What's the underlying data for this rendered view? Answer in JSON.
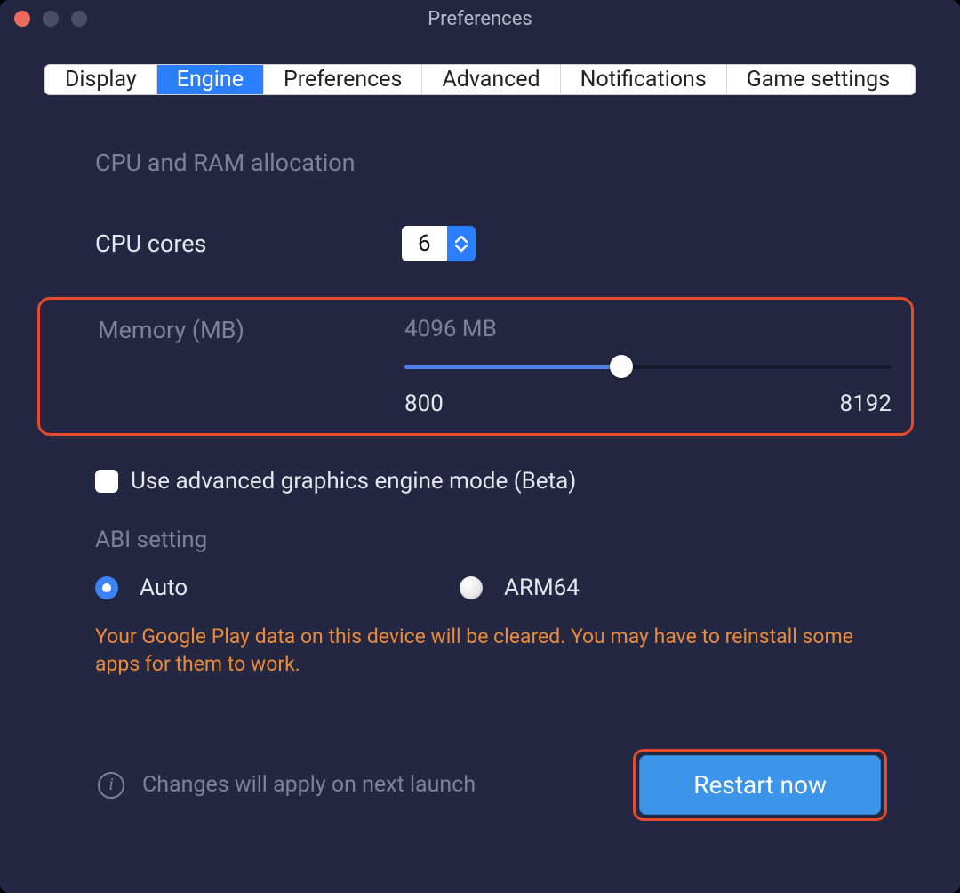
{
  "window": {
    "title": "Preferences"
  },
  "tabs": [
    {
      "label": "Display",
      "active": false
    },
    {
      "label": "Engine",
      "active": true
    },
    {
      "label": "Preferences",
      "active": false
    },
    {
      "label": "Advanced",
      "active": false
    },
    {
      "label": "Notifications",
      "active": false
    },
    {
      "label": "Game settings",
      "active": false
    }
  ],
  "section_heading": "CPU and RAM allocation",
  "cpu": {
    "label": "CPU cores",
    "value": "6"
  },
  "memory": {
    "label": "Memory (MB)",
    "value_display": "4096 MB",
    "value": 4096,
    "min": 800,
    "max": 8192,
    "min_label": "800",
    "max_label": "8192"
  },
  "advanced_graphics": {
    "label": "Use advanced graphics engine mode (Beta)",
    "checked": false
  },
  "abi": {
    "heading": "ABI setting",
    "options": [
      {
        "label": "Auto",
        "selected": true
      },
      {
        "label": "ARM64",
        "selected": false
      }
    ],
    "warning": "Your Google Play data on this device will be cleared. You may have to reinstall some apps for them to work."
  },
  "footer": {
    "note": "Changes will apply on next launch",
    "restart_label": "Restart now"
  }
}
